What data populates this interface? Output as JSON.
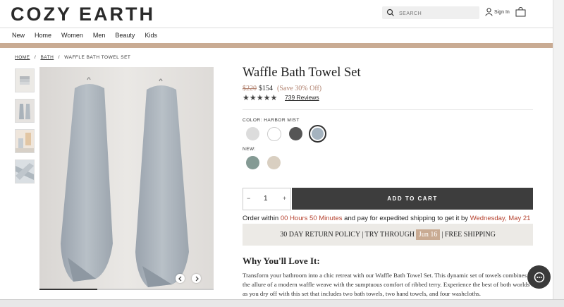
{
  "header": {
    "logo": "COZY EARTH",
    "search_placeholder": "SEARCH",
    "sign_in": "Sign In"
  },
  "nav": [
    "New",
    "Home",
    "Women",
    "Men",
    "Beauty",
    "Kids"
  ],
  "breadcrumb": {
    "home": "HOME",
    "sep1": "/",
    "bath": "BATH",
    "sep2": "/",
    "current": "WAFFLE BATH TOWEL SET"
  },
  "product": {
    "title": "Waffle Bath Towel Set",
    "old_price": "$220",
    "new_price": "$154",
    "savings": "(Save 30% Off)",
    "stars": "★★★★★",
    "rating_out_of_5": 5,
    "reviews": "739 Reviews",
    "color_label": "COLOR: HARBOR MIST",
    "colors": [
      "#dcdcdc",
      "#ffffff",
      "#555555",
      "#a5b3bf"
    ],
    "new_label": "NEW:",
    "new_colors": [
      "#849a94",
      "#d9cfc1"
    ],
    "quantity": "1",
    "qty_minus": "−",
    "qty_plus": "+",
    "add_to_cart": "ADD TO CART"
  },
  "shipping": {
    "order_prefix": "Order within",
    "countdown": "00 Hours 50 Minutes",
    "order_mid": "and pay for expedited shipping to get it by",
    "delivery_date": "Wednesday, May 21"
  },
  "policy": {
    "text1": "30 DAY RETURN POLICY | TRY THROUGH",
    "date": "Jun 16",
    "text2": "| FREE SHIPPING"
  },
  "why": {
    "heading": "Why You'll Love It:",
    "body": "Transform your bathroom into a chic retreat with our Waffle Bath Towel Set. This dynamic set of towels combines the allure of a modern waffle weave with the sumptuous comfort of ribbed terry. Experience the best of both worlds as you dry off with this set that includes two bath towels, two hand towels, and four washcloths."
  },
  "colors": {
    "accent_band": "#c9ab93",
    "price_accent": "#b0806d",
    "countdown_red": "#b5422f",
    "button_dark": "#3d3d3d"
  }
}
